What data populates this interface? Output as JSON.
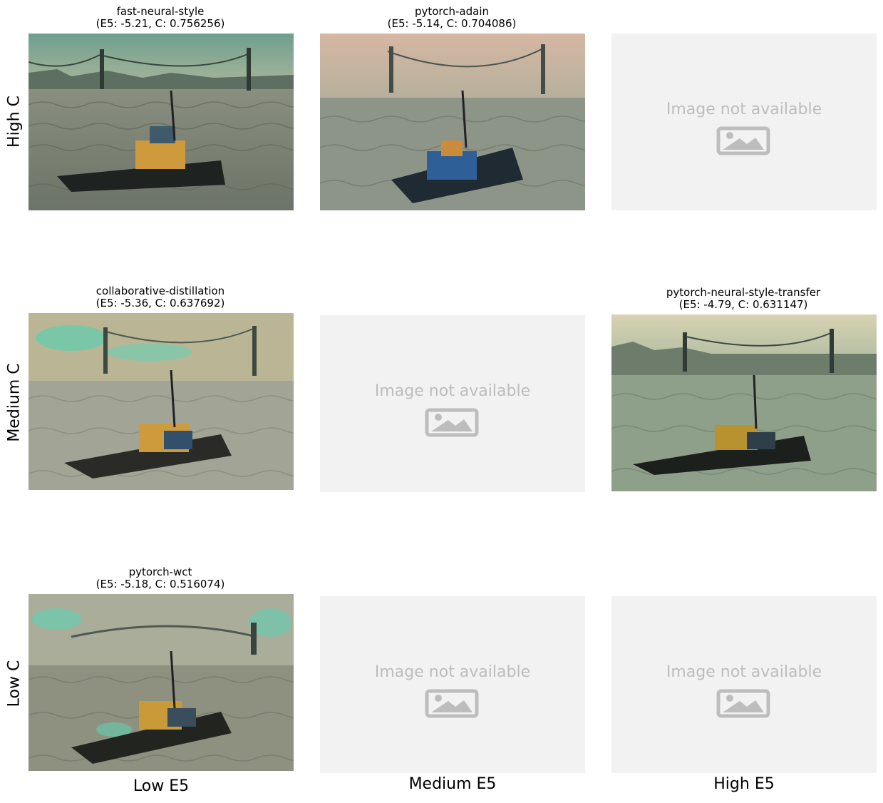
{
  "row_labels": [
    "High C",
    "Medium C",
    "Low C"
  ],
  "col_labels": [
    "Low E5",
    "Medium E5",
    "High E5"
  ],
  "unavailable_text": "Image not available",
  "cells": [
    {
      "row": 0,
      "col": 0,
      "available": true,
      "title": "fast-neural-style",
      "subtitle": "(E5: -5.21, C: 0.756256)"
    },
    {
      "row": 0,
      "col": 1,
      "available": true,
      "title": "pytorch-adain",
      "subtitle": "(E5: -5.14, C: 0.704086)"
    },
    {
      "row": 0,
      "col": 2,
      "available": false
    },
    {
      "row": 1,
      "col": 0,
      "available": true,
      "title": "collaborative-distillation",
      "subtitle": "(E5: -5.36, C: 0.637692)"
    },
    {
      "row": 1,
      "col": 1,
      "available": false
    },
    {
      "row": 1,
      "col": 2,
      "available": true,
      "title": "pytorch-neural-style-transfer",
      "subtitle": "(E5: -4.79, C: 0.631147)"
    },
    {
      "row": 2,
      "col": 0,
      "available": true,
      "title": "pytorch-wct",
      "subtitle": "(E5: -5.18, C: 0.516074)"
    },
    {
      "row": 2,
      "col": 1,
      "available": false
    },
    {
      "row": 2,
      "col": 2,
      "available": false
    }
  ],
  "colors": {
    "placeholder_bg": "#f2f2f2",
    "placeholder_text": "#bdbdbd"
  }
}
